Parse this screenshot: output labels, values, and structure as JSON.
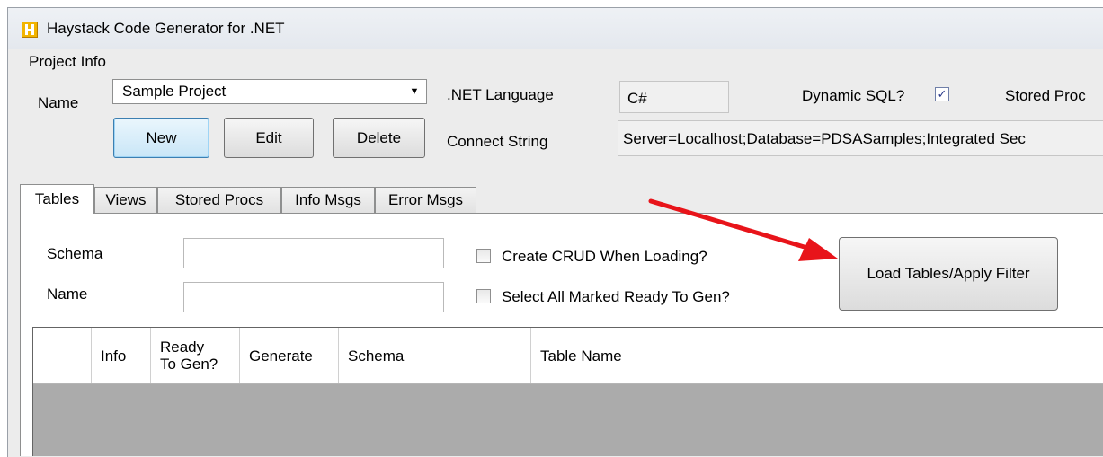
{
  "window": {
    "title": "Haystack Code Generator for .NET"
  },
  "project_info": {
    "group_label": "Project Info",
    "name_label": "Name",
    "name_value": "Sample Project",
    "language_label": ".NET Language",
    "language_value": "C#",
    "dynamic_sql_label": "Dynamic SQL?",
    "dynamic_sql_checked": true,
    "stored_proc_label": "Stored Proc",
    "connect_label": "Connect String",
    "connect_value": "Server=Localhost;Database=PDSASamples;Integrated Sec",
    "buttons": {
      "new": "New",
      "edit": "Edit",
      "delete": "Delete"
    }
  },
  "tabs": [
    "Tables",
    "Views",
    "Stored Procs",
    "Info Msgs",
    "Error Msgs"
  ],
  "filter": {
    "schema_label": "Schema",
    "schema_value": "",
    "name_label": "Name",
    "name_value": "",
    "create_crud_label": "Create CRUD When Loading?",
    "select_all_label": "Select All Marked Ready To Gen?",
    "load_button": "Load Tables/Apply Filter"
  },
  "grid": {
    "columns": [
      "Info",
      "Ready\nTo Gen?",
      "Generate",
      "Schema",
      "Table Name"
    ]
  },
  "colors": {
    "annotation_arrow": "#e8141a"
  }
}
